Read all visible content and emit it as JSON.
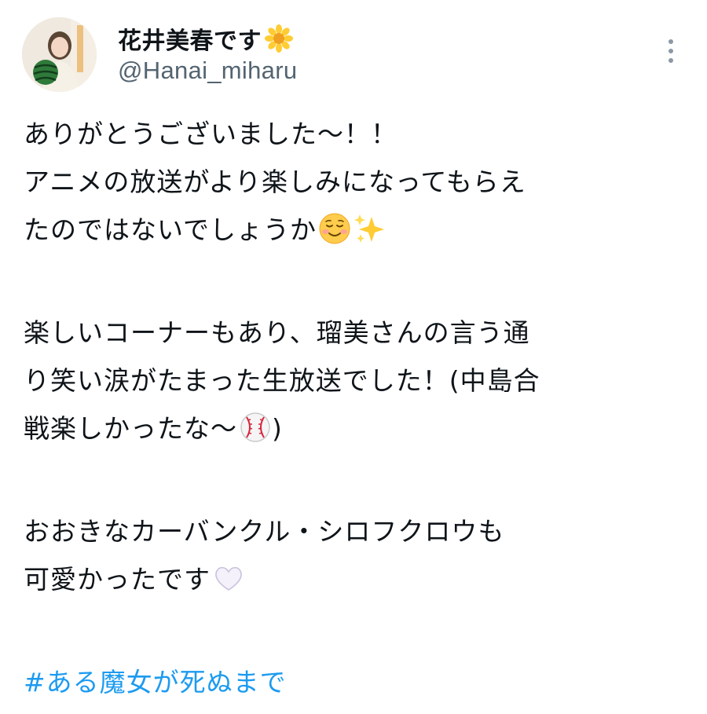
{
  "user": {
    "display_name": "花井美春です",
    "display_name_emoji": "sunflower-icon",
    "handle": "@Hanai_miharu"
  },
  "tweet": {
    "para1": {
      "line1": "ありがとうございました〜！！",
      "line2": "アニメの放送がより楽しみになってもらえ",
      "line3": "たのではないでしょうか"
    },
    "para2": {
      "line1": "楽しいコーナーもあり、瑠美さんの言う通",
      "line2": "り笑い涙がたまった生放送でした！(中島合",
      "line3_a": "戦楽しかったな〜",
      "line3_b": ")"
    },
    "para3": {
      "line1": "おおきなカーバンクル・シロフクロウも",
      "line2": "可愛かったです"
    },
    "hashtag": "#ある魔女が死ぬまで"
  },
  "colors": {
    "text": "#0f1419",
    "secondary": "#536471",
    "link": "#1d9bf0"
  }
}
